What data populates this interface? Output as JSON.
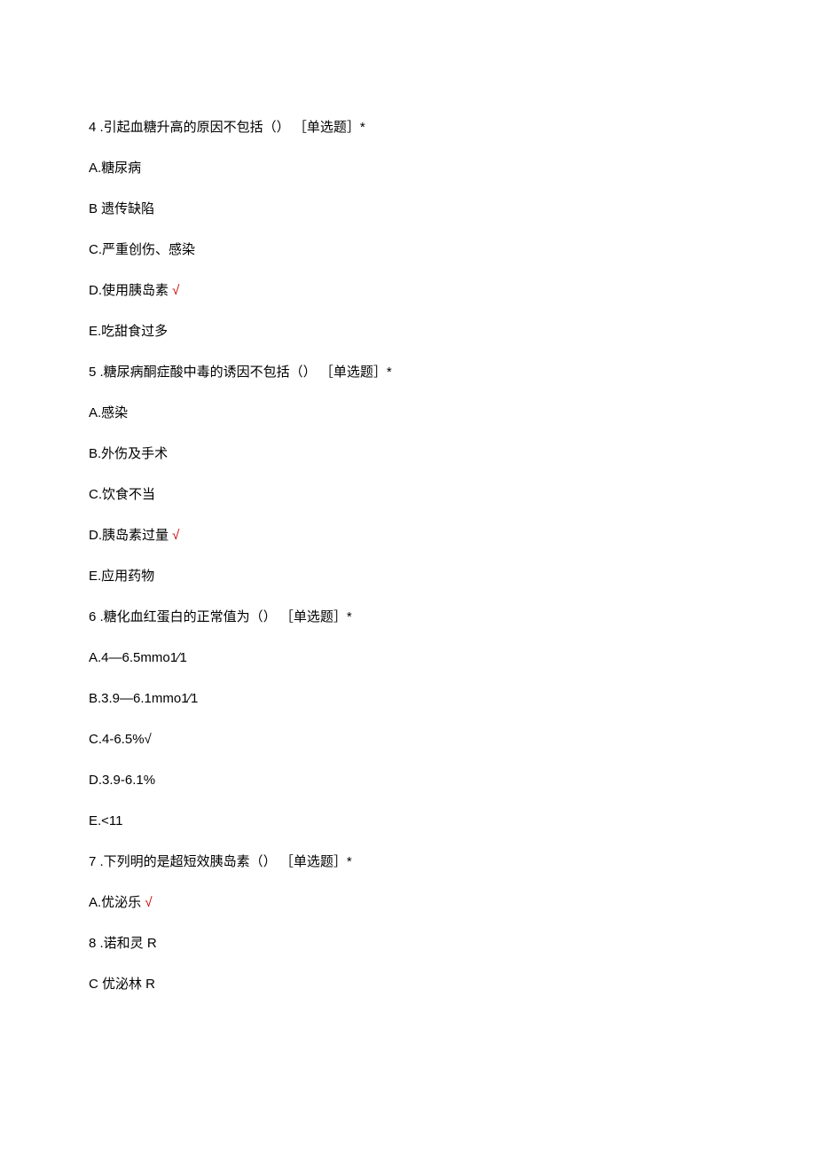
{
  "questions": [
    {
      "number": "4",
      "text": "  .引起血糖升高的原因不包括（） ［单选题］*",
      "options": [
        {
          "label": "A.糖尿病",
          "correct": false
        },
        {
          "label": "B 遗传缺陷",
          "correct": false
        },
        {
          "label": "C.严重创伤、感染",
          "correct": false
        },
        {
          "label": "D.使用胰岛素",
          "correct": true
        },
        {
          "label": "E.吃甜食过多",
          "correct": false
        }
      ]
    },
    {
      "number": "5",
      "text": "  .糖尿病酮症酸中毒的诱因不包括（） ［单选题］*",
      "options": [
        {
          "label": "A.感染",
          "correct": false
        },
        {
          "label": "B.外伤及手术",
          "correct": false
        },
        {
          "label": "C.饮食不当",
          "correct": false
        },
        {
          "label": "D.胰岛素过量",
          "correct": true
        },
        {
          "label": "E.应用药物",
          "correct": false
        }
      ]
    },
    {
      "number": "6",
      "text": "  .糖化血红蛋白的正常值为（） ［单选题］*",
      "options": [
        {
          "label": "A.4—6.5mmo1∕1",
          "correct": false
        },
        {
          "label": "B.3.9—6.1mmo1∕1",
          "correct": false
        },
        {
          "label": "C.4-6.5%√",
          "correct": false
        },
        {
          "label": "D.3.9-6.1%",
          "correct": false
        },
        {
          "label": "E.<11",
          "correct": false
        }
      ]
    },
    {
      "number": "7",
      "text": "  .下列明的是超短效胰岛素（） ［单选题］*",
      "options": [
        {
          "label": "A.优泌乐",
          "correct": true
        },
        {
          "label": "8  .诺和灵 R",
          "correct": false
        },
        {
          "label": "C 优泌林 R",
          "correct": false
        }
      ]
    }
  ],
  "check_symbol": " √"
}
